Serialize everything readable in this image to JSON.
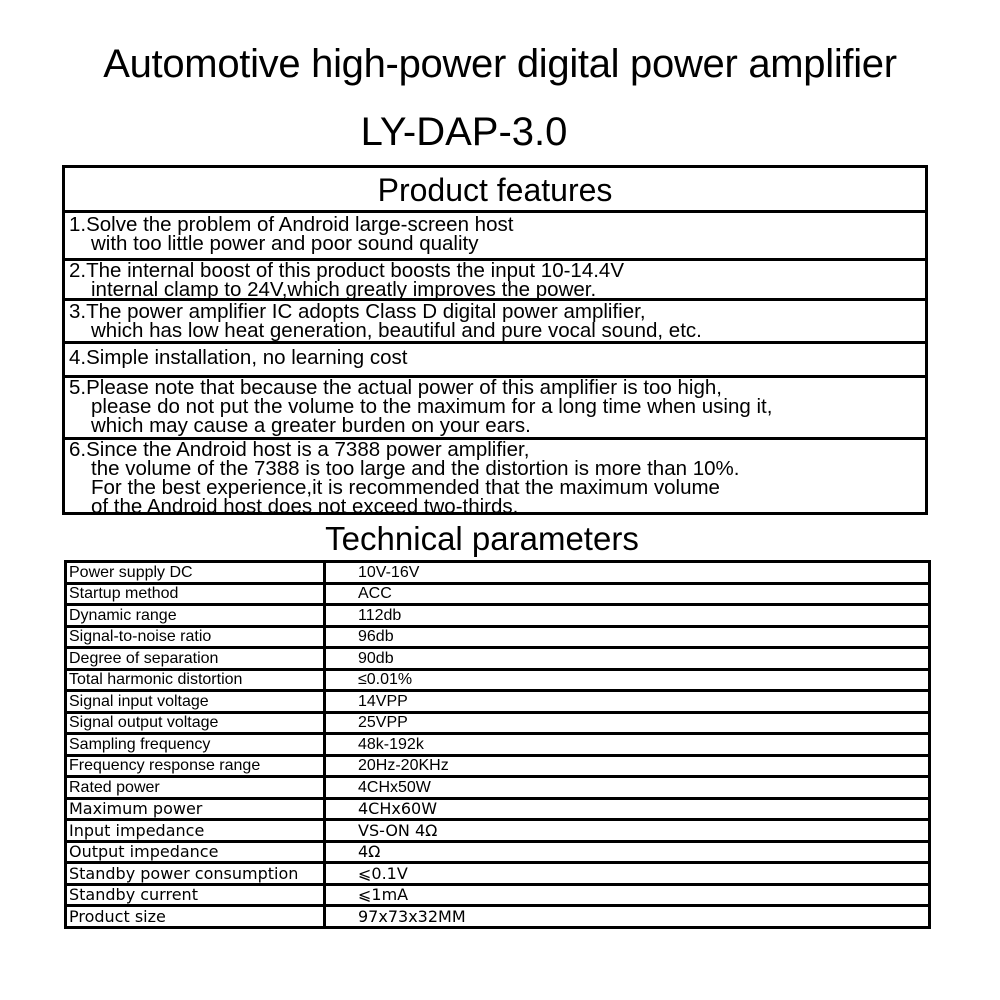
{
  "header": {
    "title": "Automotive high-power digital power amplifier",
    "model": "LY-DAP-3.0"
  },
  "features": {
    "heading": "Product features",
    "items": [
      {
        "lines": [
          "1.Solve the problem of Android large-screen host",
          "with too little power and poor sound quality"
        ]
      },
      {
        "lines": [
          "2.The internal boost of this product boosts the input 10-14.4V",
          "internal clamp to 24V,which greatly improves the power."
        ]
      },
      {
        "lines": [
          "3.The power amplifier IC adopts Class D digital power amplifier,",
          "which has low heat generation, beautiful and pure vocal sound, etc."
        ]
      },
      {
        "lines": [
          "4.Simple installation, no learning cost"
        ]
      },
      {
        "lines": [
          "5.Please note that because the actual power of this amplifier is too high,",
          "please do not put the volume to the maximum for a long time when using it,",
          "which may cause a greater burden on your ears."
        ]
      },
      {
        "lines": [
          "6.Since the Android host is a 7388 power amplifier,",
          "the volume of the 7388 is too large and the distortion is more than 10%.",
          "For the best experience,it is recommended that the maximum volume",
          "of the Android host does not exceed two-thirds."
        ]
      }
    ]
  },
  "technical": {
    "heading": "Technical parameters",
    "rows": [
      {
        "param": "Power supply DC",
        "value": "10V-16V"
      },
      {
        "param": "Startup method",
        "value": "ACC"
      },
      {
        "param": "Dynamic range",
        "value": "112db"
      },
      {
        "param": "Signal-to-noise ratio",
        "value": "96db"
      },
      {
        "param": "Degree of separation",
        "value": "90db"
      },
      {
        "param": "Total harmonic distortion",
        "value": "≤0.01%"
      },
      {
        "param": "Signal input voltage",
        "value": "14VPP"
      },
      {
        "param": "Signal output voltage",
        "value": "25VPP"
      },
      {
        "param": "Sampling frequency",
        "value": "48k-192k"
      },
      {
        "param": "Frequency response range",
        "value": "20Hz-20KHz"
      },
      {
        "param": "Rated power",
        "value": "4CHx50W"
      },
      {
        "param": "Maximum power",
        "value": "4CHx60W"
      },
      {
        "param": "Input impedance",
        "value": "VS-ON 4Ω"
      },
      {
        "param": "Output impedance",
        "value": "4Ω"
      },
      {
        "param": "Standby power consumption",
        "value": "⩽0.1V"
      },
      {
        "param": "Standby current",
        "value": "⩽1mA"
      },
      {
        "param": "Product size",
        "value": "97x73x32MM"
      }
    ]
  }
}
